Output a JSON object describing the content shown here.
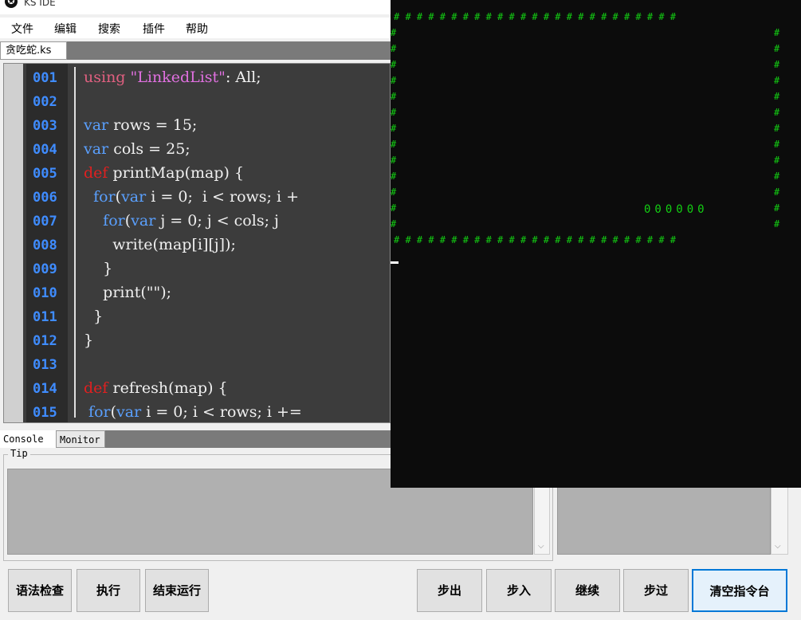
{
  "window": {
    "title": "KS IDE",
    "icon": "app-logo-icon"
  },
  "menu": [
    "文件",
    "编辑",
    "搜索",
    "插件",
    "帮助"
  ],
  "file_tab": "贪吃蛇.ks",
  "editor": {
    "line_numbers": [
      "001",
      "002",
      "003",
      "004",
      "005",
      "006",
      "007",
      "008",
      "009",
      "010",
      "011",
      "012",
      "013",
      "014",
      "015"
    ]
  },
  "console": {
    "tabs": [
      "Console",
      "Monitor"
    ],
    "tip_label": "Tip"
  },
  "buttons_left": [
    "语法检查",
    "执行",
    "结束运行"
  ],
  "buttons_right": [
    "步出",
    "步入",
    "继续",
    "步过",
    "清空指令台"
  ],
  "terminal": {
    "top_border": "# # # # # # # # # # # # # # # # # # # # # # # # #",
    "side_char": "#",
    "snake": "000000",
    "colors": {
      "text": "#13d013",
      "background": "#0c0c0c"
    }
  },
  "colors": {
    "editor_bg": "#3c3c3c",
    "line_number": "#3f8cff",
    "keyword": "#5aa0ff",
    "def_keyword": "#e02020",
    "accent": "#0078d7"
  }
}
